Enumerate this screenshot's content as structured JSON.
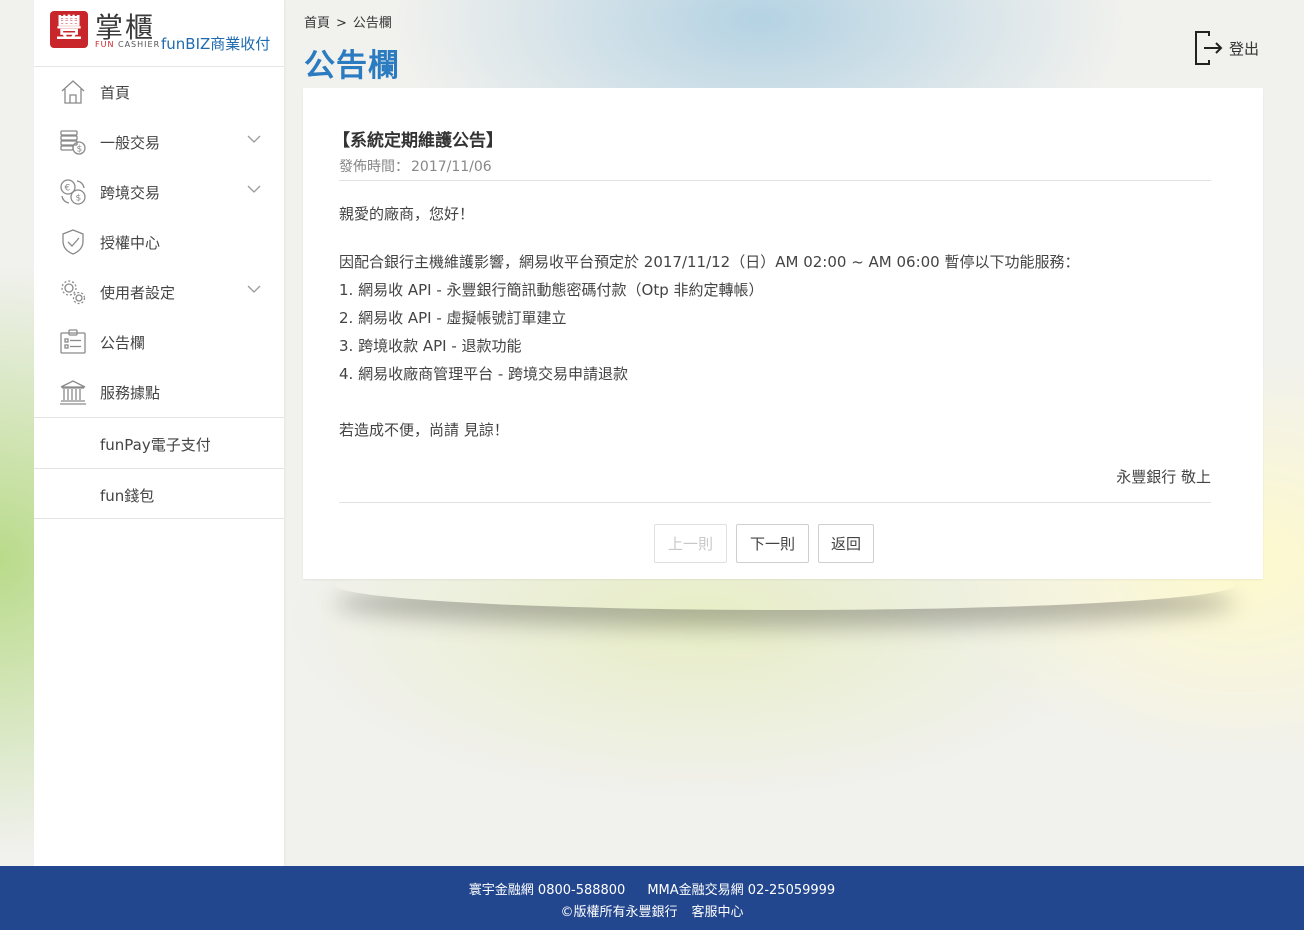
{
  "logo": {
    "mark": "豐",
    "name_cn": "掌櫃",
    "name_en_prefix": "FUN",
    "name_en_suffix": "CASHIER",
    "product": "funBIZ商業收付"
  },
  "sidebar": {
    "items": [
      {
        "label": "首頁",
        "icon": "home-icon",
        "has_submenu": false
      },
      {
        "label": "一般交易",
        "icon": "coins-dollar-icon",
        "has_submenu": true
      },
      {
        "label": "跨境交易",
        "icon": "currency-exchange-icon",
        "has_submenu": true
      },
      {
        "label": "授權中心",
        "icon": "shield-check-icon",
        "has_submenu": false
      },
      {
        "label": "使用者設定",
        "icon": "gears-icon",
        "has_submenu": true
      },
      {
        "label": "公告欄",
        "icon": "clipboard-icon",
        "has_submenu": false
      },
      {
        "label": "服務據點",
        "icon": "bank-icon",
        "has_submenu": false
      }
    ],
    "extra_links": [
      "funPay電子支付",
      "fun錢包"
    ]
  },
  "header": {
    "breadcrumb": [
      "首頁",
      "公告欄"
    ],
    "breadcrumb_sep": ">",
    "title": "公告欄",
    "logout_label": "登出"
  },
  "announcement": {
    "title": "【系統定期維護公告】",
    "date_label": "發佈時間：",
    "date": "2017/11/06",
    "greeting": "親愛的廠商，您好！",
    "intro": "因配合銀行主機維護影響，網易收平台預定於 2017/11/12（日）AM 02:00 ~ AM 06:00 暫停以下功能服務：",
    "items": [
      "1. 網易收 API - 永豐銀行簡訊動態密碼付款（Otp 非約定轉帳）",
      "2. 網易收 API - 虛擬帳號訂單建立",
      "3. 跨境收款 API - 退款功能",
      "4. 網易收廠商管理平台 - 跨境交易申請退款"
    ],
    "closing": "若造成不便，尚請 見諒！",
    "signature": "永豐銀行 敬上"
  },
  "buttons": {
    "prev": "上一則",
    "next": "下一則",
    "back": "返回"
  },
  "footer": {
    "hotline1": "寰宇金融網 0800-588800",
    "hotline2": "MMA金融交易網 02-25059999",
    "copyright": "©版權所有永豐銀行",
    "service": "客服中心"
  },
  "colors": {
    "accent": "#2b7bc0",
    "brand_red": "#c8262b",
    "footer_bg": "#23478f"
  }
}
